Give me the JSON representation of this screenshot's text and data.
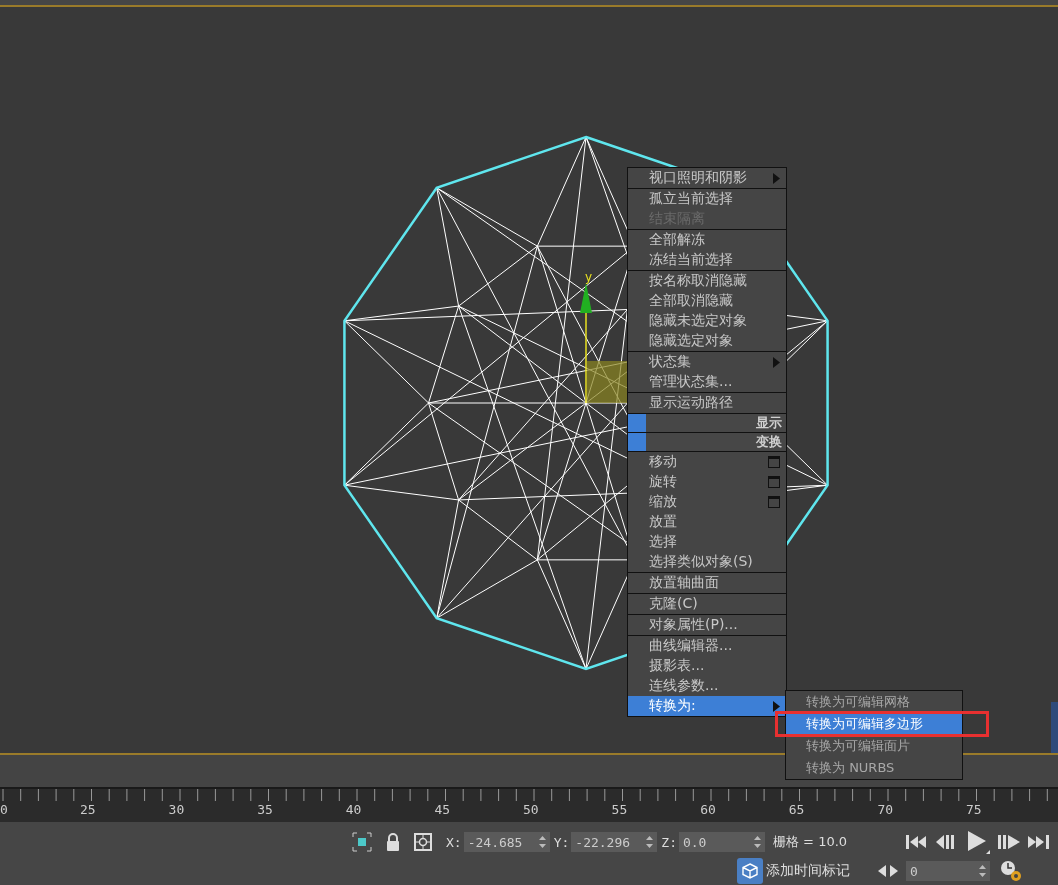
{
  "viewport": {
    "gizmo_label": "y"
  },
  "context_menu": {
    "sections": [
      [
        {
          "label": "视口照明和阴影",
          "kind": "submenu",
          "disabled": false,
          "selected": false
        }
      ],
      [
        {
          "label": "孤立当前选择",
          "kind": "item",
          "disabled": false,
          "selected": false
        },
        {
          "label": "结束隔离",
          "kind": "item",
          "disabled": true,
          "selected": false
        }
      ],
      [
        {
          "label": "全部解冻",
          "kind": "item",
          "disabled": false,
          "selected": false
        },
        {
          "label": "冻结当前选择",
          "kind": "item",
          "disabled": false,
          "selected": false
        }
      ],
      [
        {
          "label": "按名称取消隐藏",
          "kind": "item",
          "disabled": false,
          "selected": false
        },
        {
          "label": "全部取消隐藏",
          "kind": "item",
          "disabled": false,
          "selected": false
        },
        {
          "label": "隐藏未选定对象",
          "kind": "item",
          "disabled": false,
          "selected": false
        },
        {
          "label": "隐藏选定对象",
          "kind": "item",
          "disabled": false,
          "selected": false
        }
      ],
      [
        {
          "label": "状态集",
          "kind": "submenu",
          "disabled": false,
          "selected": false
        },
        {
          "label": "管理状态集...",
          "kind": "item",
          "disabled": false,
          "selected": false
        }
      ],
      [
        {
          "label": "显示运动路径",
          "kind": "item",
          "disabled": false,
          "selected": false
        }
      ],
      [
        {
          "label": "显示",
          "kind": "header"
        }
      ],
      [
        {
          "label": "变换",
          "kind": "header"
        }
      ],
      [
        {
          "label": "移动",
          "kind": "options",
          "disabled": false,
          "selected": false
        },
        {
          "label": "旋转",
          "kind": "options",
          "disabled": false,
          "selected": false
        },
        {
          "label": "缩放",
          "kind": "options",
          "disabled": false,
          "selected": false
        },
        {
          "label": "放置",
          "kind": "item",
          "disabled": false,
          "selected": false
        },
        {
          "label": "选择",
          "kind": "item",
          "disabled": false,
          "selected": false
        },
        {
          "label": "选择类似对象(S)",
          "kind": "item",
          "disabled": false,
          "selected": false
        }
      ],
      [
        {
          "label": "放置轴曲面",
          "kind": "item",
          "disabled": false,
          "selected": false
        }
      ],
      [
        {
          "label": "克隆(C)",
          "kind": "item",
          "disabled": false,
          "selected": false
        }
      ],
      [
        {
          "label": "对象属性(P)...",
          "kind": "item",
          "disabled": false,
          "selected": false
        }
      ],
      [
        {
          "label": "曲线编辑器...",
          "kind": "item",
          "disabled": false,
          "selected": false
        },
        {
          "label": "摄影表...",
          "kind": "item",
          "disabled": false,
          "selected": false
        },
        {
          "label": "连线参数...",
          "kind": "item",
          "disabled": false,
          "selected": false
        },
        {
          "label": "转换为:",
          "kind": "submenu",
          "disabled": false,
          "selected": true
        }
      ]
    ]
  },
  "submenu": {
    "items": [
      {
        "label": "转换为可编辑网格",
        "selected": false
      },
      {
        "label": "转换为可编辑多边形",
        "selected": true
      },
      {
        "label": "转换为可编辑面片",
        "selected": false
      },
      {
        "label": "转换为 NURBS",
        "selected": false
      }
    ]
  },
  "timeline": {
    "labels": [
      "0",
      "25",
      "30",
      "35",
      "40",
      "45",
      "50",
      "55",
      "60",
      "65",
      "70",
      "75"
    ]
  },
  "status_bar": {
    "coords": [
      {
        "axis": "X:",
        "value": "-24.685"
      },
      {
        "axis": "Y:",
        "value": "-22.296"
      },
      {
        "axis": "Z:",
        "value": "0.0"
      }
    ],
    "grid": "栅格 = 10.0",
    "add_time_tag": "添加时间标记",
    "frame": "0"
  }
}
